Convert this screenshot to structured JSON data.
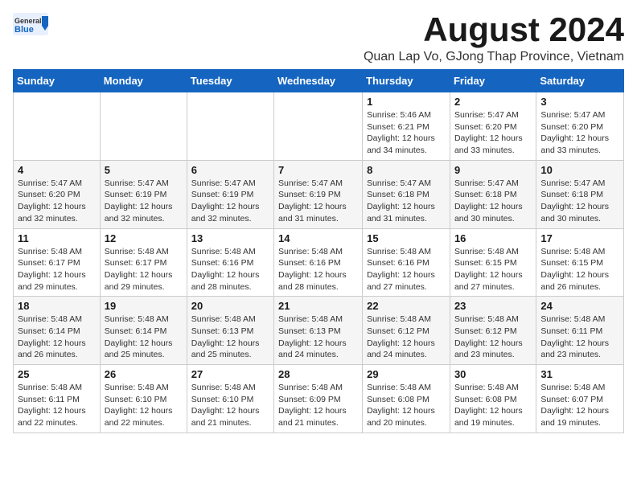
{
  "header": {
    "logo_general": "General",
    "logo_blue": "Blue",
    "month_title": "August 2024",
    "subtitle": "Quan Lap Vo, GJong Thap Province, Vietnam"
  },
  "weekdays": [
    "Sunday",
    "Monday",
    "Tuesday",
    "Wednesday",
    "Thursday",
    "Friday",
    "Saturday"
  ],
  "weeks": [
    [
      {
        "day": "",
        "info": ""
      },
      {
        "day": "",
        "info": ""
      },
      {
        "day": "",
        "info": ""
      },
      {
        "day": "",
        "info": ""
      },
      {
        "day": "1",
        "info": "Sunrise: 5:46 AM\nSunset: 6:21 PM\nDaylight: 12 hours\nand 34 minutes."
      },
      {
        "day": "2",
        "info": "Sunrise: 5:47 AM\nSunset: 6:20 PM\nDaylight: 12 hours\nand 33 minutes."
      },
      {
        "day": "3",
        "info": "Sunrise: 5:47 AM\nSunset: 6:20 PM\nDaylight: 12 hours\nand 33 minutes."
      }
    ],
    [
      {
        "day": "4",
        "info": "Sunrise: 5:47 AM\nSunset: 6:20 PM\nDaylight: 12 hours\nand 32 minutes."
      },
      {
        "day": "5",
        "info": "Sunrise: 5:47 AM\nSunset: 6:19 PM\nDaylight: 12 hours\nand 32 minutes."
      },
      {
        "day": "6",
        "info": "Sunrise: 5:47 AM\nSunset: 6:19 PM\nDaylight: 12 hours\nand 32 minutes."
      },
      {
        "day": "7",
        "info": "Sunrise: 5:47 AM\nSunset: 6:19 PM\nDaylight: 12 hours\nand 31 minutes."
      },
      {
        "day": "8",
        "info": "Sunrise: 5:47 AM\nSunset: 6:18 PM\nDaylight: 12 hours\nand 31 minutes."
      },
      {
        "day": "9",
        "info": "Sunrise: 5:47 AM\nSunset: 6:18 PM\nDaylight: 12 hours\nand 30 minutes."
      },
      {
        "day": "10",
        "info": "Sunrise: 5:47 AM\nSunset: 6:18 PM\nDaylight: 12 hours\nand 30 minutes."
      }
    ],
    [
      {
        "day": "11",
        "info": "Sunrise: 5:48 AM\nSunset: 6:17 PM\nDaylight: 12 hours\nand 29 minutes."
      },
      {
        "day": "12",
        "info": "Sunrise: 5:48 AM\nSunset: 6:17 PM\nDaylight: 12 hours\nand 29 minutes."
      },
      {
        "day": "13",
        "info": "Sunrise: 5:48 AM\nSunset: 6:16 PM\nDaylight: 12 hours\nand 28 minutes."
      },
      {
        "day": "14",
        "info": "Sunrise: 5:48 AM\nSunset: 6:16 PM\nDaylight: 12 hours\nand 28 minutes."
      },
      {
        "day": "15",
        "info": "Sunrise: 5:48 AM\nSunset: 6:16 PM\nDaylight: 12 hours\nand 27 minutes."
      },
      {
        "day": "16",
        "info": "Sunrise: 5:48 AM\nSunset: 6:15 PM\nDaylight: 12 hours\nand 27 minutes."
      },
      {
        "day": "17",
        "info": "Sunrise: 5:48 AM\nSunset: 6:15 PM\nDaylight: 12 hours\nand 26 minutes."
      }
    ],
    [
      {
        "day": "18",
        "info": "Sunrise: 5:48 AM\nSunset: 6:14 PM\nDaylight: 12 hours\nand 26 minutes."
      },
      {
        "day": "19",
        "info": "Sunrise: 5:48 AM\nSunset: 6:14 PM\nDaylight: 12 hours\nand 25 minutes."
      },
      {
        "day": "20",
        "info": "Sunrise: 5:48 AM\nSunset: 6:13 PM\nDaylight: 12 hours\nand 25 minutes."
      },
      {
        "day": "21",
        "info": "Sunrise: 5:48 AM\nSunset: 6:13 PM\nDaylight: 12 hours\nand 24 minutes."
      },
      {
        "day": "22",
        "info": "Sunrise: 5:48 AM\nSunset: 6:12 PM\nDaylight: 12 hours\nand 24 minutes."
      },
      {
        "day": "23",
        "info": "Sunrise: 5:48 AM\nSunset: 6:12 PM\nDaylight: 12 hours\nand 23 minutes."
      },
      {
        "day": "24",
        "info": "Sunrise: 5:48 AM\nSunset: 6:11 PM\nDaylight: 12 hours\nand 23 minutes."
      }
    ],
    [
      {
        "day": "25",
        "info": "Sunrise: 5:48 AM\nSunset: 6:11 PM\nDaylight: 12 hours\nand 22 minutes."
      },
      {
        "day": "26",
        "info": "Sunrise: 5:48 AM\nSunset: 6:10 PM\nDaylight: 12 hours\nand 22 minutes."
      },
      {
        "day": "27",
        "info": "Sunrise: 5:48 AM\nSunset: 6:10 PM\nDaylight: 12 hours\nand 21 minutes."
      },
      {
        "day": "28",
        "info": "Sunrise: 5:48 AM\nSunset: 6:09 PM\nDaylight: 12 hours\nand 21 minutes."
      },
      {
        "day": "29",
        "info": "Sunrise: 5:48 AM\nSunset: 6:08 PM\nDaylight: 12 hours\nand 20 minutes."
      },
      {
        "day": "30",
        "info": "Sunrise: 5:48 AM\nSunset: 6:08 PM\nDaylight: 12 hours\nand 19 minutes."
      },
      {
        "day": "31",
        "info": "Sunrise: 5:48 AM\nSunset: 6:07 PM\nDaylight: 12 hours\nand 19 minutes."
      }
    ]
  ]
}
